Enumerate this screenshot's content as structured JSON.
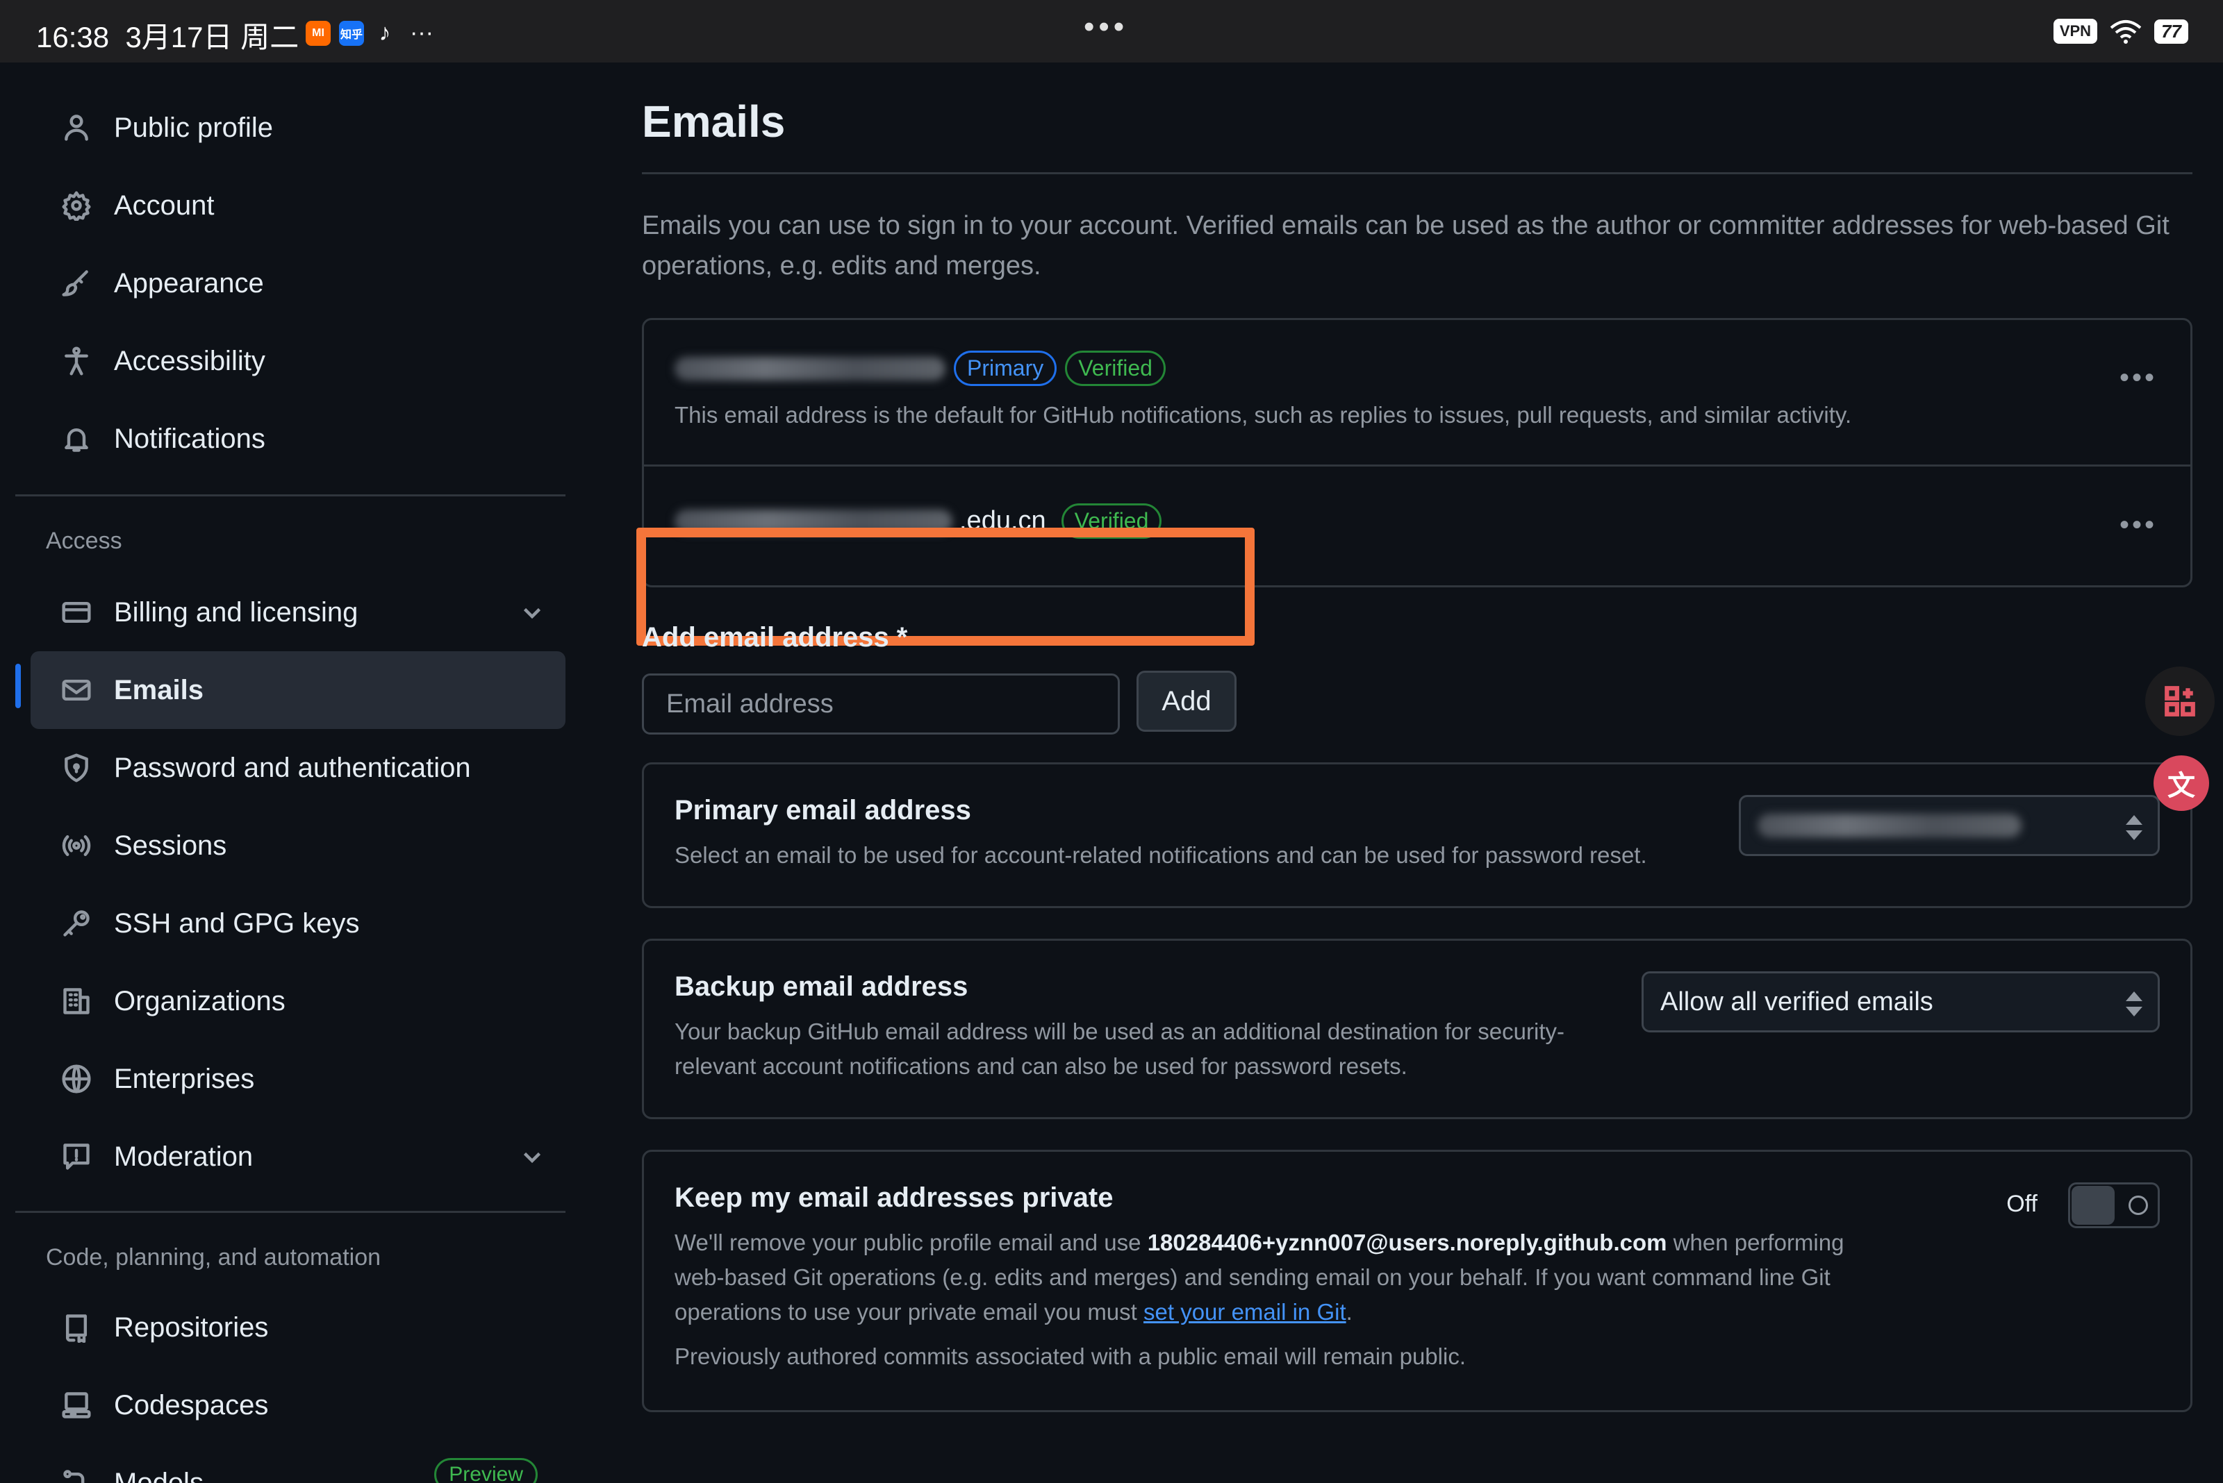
{
  "status_bar": {
    "time": "16:38",
    "date": "3月17日 周二",
    "app_mi": "MI",
    "app_zhihu": "知乎",
    "app_tiktok": "♪",
    "more": "···",
    "center_dots": "•••",
    "vpn": "VPN",
    "battery": "77"
  },
  "sidebar": {
    "items_top": [
      {
        "label": "Public profile",
        "icon": "person-icon"
      },
      {
        "label": "Account",
        "icon": "gear-icon"
      },
      {
        "label": "Appearance",
        "icon": "paintbrush-icon"
      },
      {
        "label": "Accessibility",
        "icon": "accessibility-icon"
      },
      {
        "label": "Notifications",
        "icon": "bell-icon"
      }
    ],
    "section_access": "Access",
    "items_access": [
      {
        "label": "Billing and licensing",
        "icon": "credit-card-icon"
      },
      {
        "label": "Emails",
        "icon": "mail-icon"
      },
      {
        "label": "Password and authentication",
        "icon": "shield-icon"
      },
      {
        "label": "Sessions",
        "icon": "broadcast-icon"
      },
      {
        "label": "SSH and GPG keys",
        "icon": "key-icon"
      },
      {
        "label": "Organizations",
        "icon": "organization-icon"
      },
      {
        "label": "Enterprises",
        "icon": "globe-icon"
      },
      {
        "label": "Moderation",
        "icon": "report-icon"
      }
    ],
    "section_code": "Code, planning, and automation",
    "items_code": [
      {
        "label": "Repositories",
        "icon": "repo-icon"
      },
      {
        "label": "Codespaces",
        "icon": "codespaces-icon"
      },
      {
        "label": "Models",
        "icon": "models-icon",
        "badge": "Preview"
      }
    ]
  },
  "main": {
    "title": "Emails",
    "intro": "Emails you can use to sign in to your account. Verified emails can be used as the author or committer addresses for web-based Git operations, e.g. edits and merges.",
    "emails": [
      {
        "badge_primary": "Primary",
        "badge_verified": "Verified",
        "description": "This email address is the default for GitHub notifications, such as replies to issues, pull requests, and similar activity."
      },
      {
        "suffix": ".edu.cn",
        "badge_verified": "Verified"
      }
    ],
    "add_email": {
      "label": "Add email address *",
      "placeholder": "Email address",
      "button": "Add"
    },
    "primary_card": {
      "title": "Primary email address",
      "desc": "Select an email to be used for account-related notifications and can be used for password reset."
    },
    "backup_card": {
      "title": "Backup email address",
      "desc": "Your backup GitHub email address will be used as an additional destination for security-relevant account notifications and can also be used for password resets.",
      "selected": "Allow all verified emails"
    },
    "private_card": {
      "title": "Keep my email addresses private",
      "toggle_label": "Off",
      "desc_pre": "We'll remove your public profile email and use ",
      "noreply": "180284406+yznn007@users.noreply.github.com",
      "desc_mid": " when performing web-based Git operations (e.g. edits and merges) and sending email on your behalf. If you want command line Git operations to use your private email you must ",
      "link": "set your email in Git",
      "desc_end": ".",
      "note": "Previously authored commits associated with a public email will remain public."
    }
  },
  "colors": {
    "accent": "#1f6feb",
    "verified": "#3fb950",
    "highlight": "#f4753a"
  }
}
